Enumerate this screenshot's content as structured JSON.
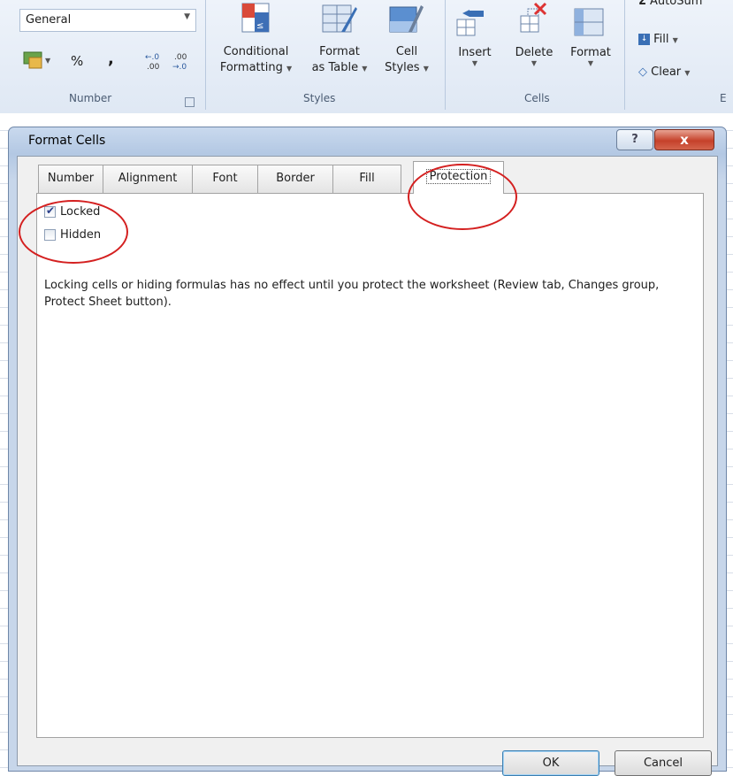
{
  "ribbon": {
    "number_format": {
      "value": "General"
    },
    "number_group": {
      "label": "Number",
      "percent": "%",
      "comma": ",",
      "increase_decimal": "←0 .00",
      "decrease_decimal": ".00 →0"
    },
    "styles_group": {
      "label": "Styles",
      "conditional_formatting": [
        "Conditional",
        "Formatting"
      ],
      "format_as_table": [
        "Format",
        "as Table"
      ],
      "cell_styles": [
        "Cell",
        "Styles"
      ]
    },
    "cells_group": {
      "label": "Cells",
      "insert": "Insert",
      "delete": "Delete",
      "format": "Format"
    },
    "editing_group": {
      "label_fragment": "E",
      "autosum": "AutoSum",
      "fill": "Fill",
      "clear": "Clear"
    }
  },
  "dialog": {
    "title": "Format Cells",
    "help": "?",
    "close": "x",
    "tabs": [
      "Number",
      "Alignment",
      "Font",
      "Border",
      "Fill",
      "Protection"
    ],
    "active_tab": "Protection",
    "options": {
      "locked": {
        "label": "Locked",
        "checked": true
      },
      "hidden": {
        "label": "Hidden",
        "checked": false
      }
    },
    "description": "Locking cells or hiding formulas has no effect until you protect the worksheet (Review tab, Changes group, Protect Sheet button).",
    "ok_label": "OK",
    "cancel_label": "Cancel"
  },
  "colors": {
    "annotation": "#d42020",
    "ribbon_bg": "#dfe8f4",
    "dialog_frame": "#b3c8e3"
  }
}
